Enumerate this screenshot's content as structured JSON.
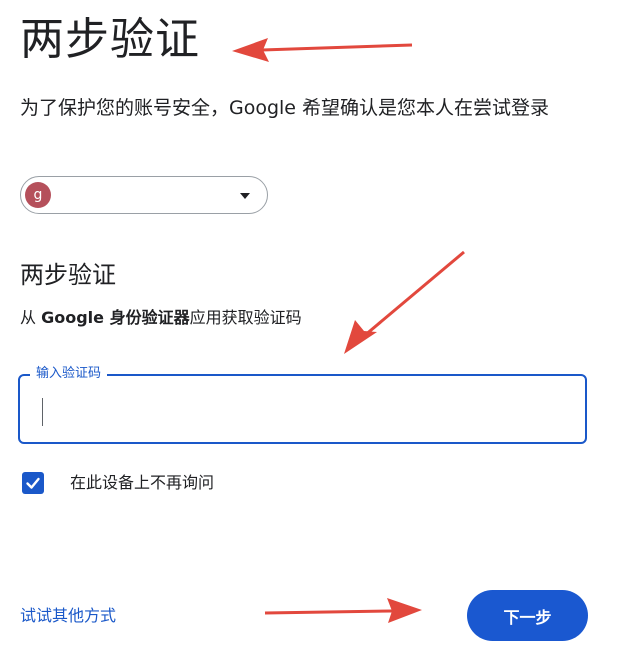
{
  "header": {
    "title": "两步验证",
    "intro": "为了保护您的账号安全，Google 希望确认是您本人在尝试登录"
  },
  "account": {
    "avatar_letter": "g",
    "avatar_color": "#b5505b",
    "icon": "chevron-down-icon"
  },
  "verification": {
    "section_title": "两步验证",
    "instruction_prefix": "从 ",
    "instruction_app": "Google 身份验证器",
    "instruction_suffix": "应用获取验证码",
    "code_label": "输入验证码",
    "code_value": "",
    "remember_checked": true,
    "remember_label": "在此设备上不再询问"
  },
  "actions": {
    "try_other": "试试其他方式",
    "next": "下一步"
  },
  "colors": {
    "accent": "#1a58d0",
    "annotation_arrow": "#e2483d"
  }
}
